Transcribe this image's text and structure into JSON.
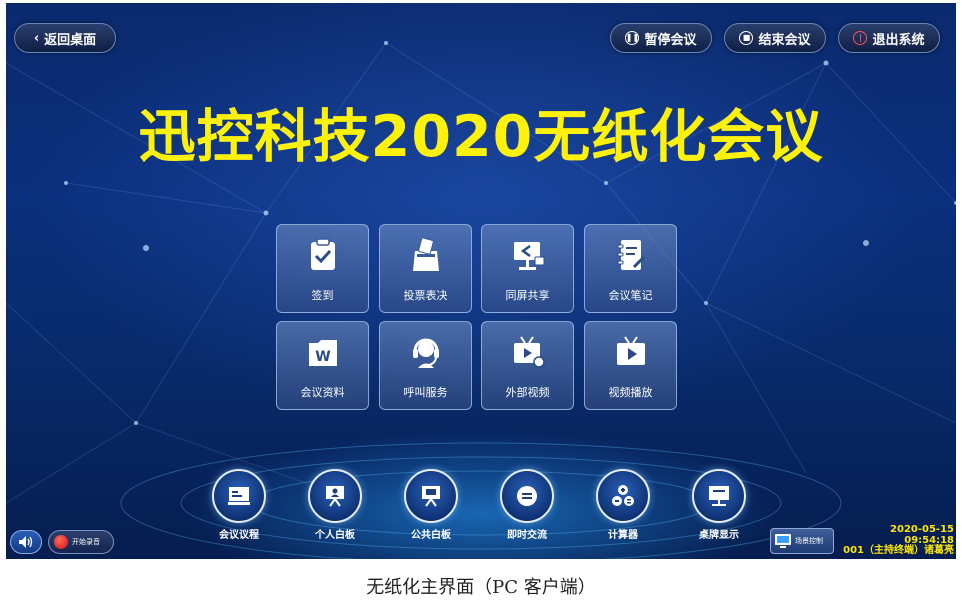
{
  "topbar": {
    "back_label": "返回桌面",
    "pause_label": "暂停会议",
    "end_label": "结束会议",
    "exit_label": "退出系统"
  },
  "title": "迅控科技2020无纸化会议",
  "tiles": [
    {
      "label": "签到",
      "icon": "clipboard-check-icon"
    },
    {
      "label": "投票表决",
      "icon": "ballot-box-icon"
    },
    {
      "label": "同屏共享",
      "icon": "screen-share-icon"
    },
    {
      "label": "会议笔记",
      "icon": "notebook-pen-icon"
    },
    {
      "label": "会议资料",
      "icon": "word-folder-icon"
    },
    {
      "label": "呼叫服务",
      "icon": "headset-icon"
    },
    {
      "label": "外部视频",
      "icon": "external-video-icon"
    },
    {
      "label": "视频播放",
      "icon": "video-play-icon"
    }
  ],
  "bottom": [
    {
      "label": "会议议程",
      "icon": "agenda-icon"
    },
    {
      "label": "个人白板",
      "icon": "personal-whiteboard-icon"
    },
    {
      "label": "公共白板",
      "icon": "public-whiteboard-icon"
    },
    {
      "label": "即时交流",
      "icon": "chat-icon"
    },
    {
      "label": "计算器",
      "icon": "calculator-icon"
    },
    {
      "label": "桌牌显示",
      "icon": "desk-sign-icon"
    }
  ],
  "status": {
    "record_label": "开始录音",
    "control_label": "场景控制",
    "datetime": "2020-05-15 09:54:18",
    "terminal": "001（主持终端）诸葛亮"
  },
  "caption": "无纸化主界面（PC 客户端）",
  "colors": {
    "title": "#fff20a",
    "status": "#ffe600",
    "background": "#0a2f7c"
  }
}
